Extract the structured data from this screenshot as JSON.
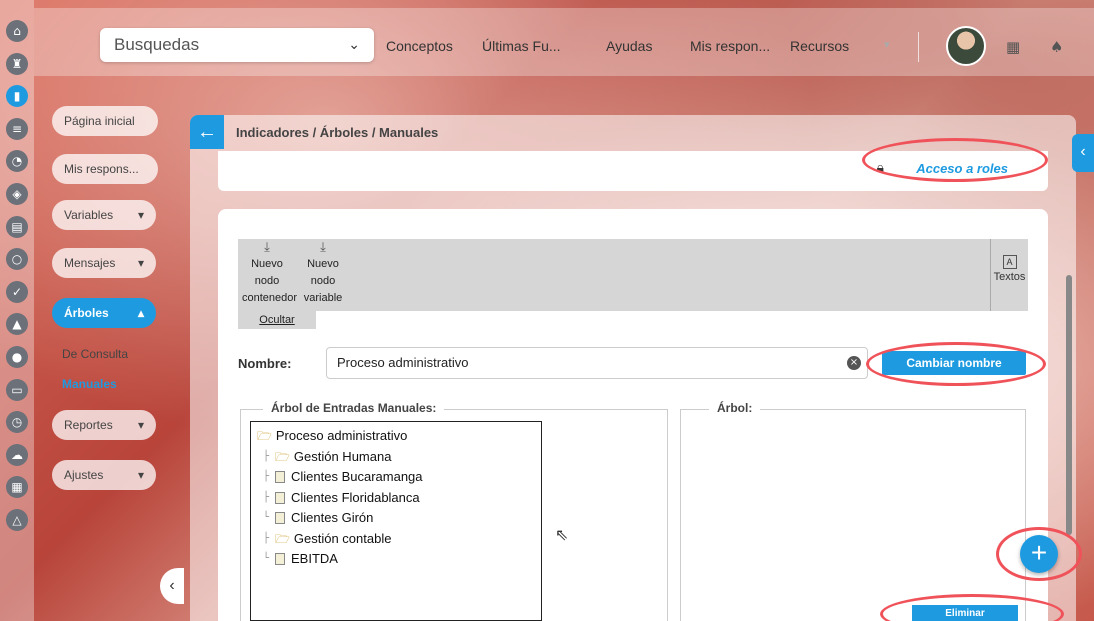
{
  "topbar": {
    "search_select": "Busquedas",
    "nav": [
      "Conceptos",
      "Últimas Fu...",
      "Ayudas",
      "Mis respon...",
      "Recursos"
    ],
    "nav_more": "▾"
  },
  "rail_icons": [
    "home-icon",
    "tower-icon",
    "chart-icon",
    "list-icon",
    "pie-icon",
    "shield-icon",
    "doc-icon",
    "circle-icon",
    "check-icon",
    "warning-icon",
    "people-icon",
    "monitor-icon",
    "clock-icon",
    "cloud-icon",
    "calendar-icon",
    "triangle-icon"
  ],
  "sidebar": {
    "items": [
      {
        "label": "Página inicial"
      },
      {
        "label": "Mis respons..."
      },
      {
        "label": "Variables",
        "arrow": "▾"
      },
      {
        "label": "Mensajes",
        "arrow": "▾"
      },
      {
        "label": "Árboles",
        "arrow": "▴"
      },
      {
        "label": "Reportes",
        "arrow": "▾"
      },
      {
        "label": "Ajustes",
        "arrow": "▾"
      }
    ],
    "subitems": [
      {
        "label": "De Consulta"
      },
      {
        "label": "Manuales"
      }
    ]
  },
  "panel": {
    "breadcrumb": "Indicadores / Árboles / Manuales",
    "roles_link": "Acceso a roles",
    "toolbar": {
      "tool1": [
        "Nuevo",
        "nodo",
        "contenedor"
      ],
      "tool2": [
        "Nuevo",
        "nodo",
        "variable"
      ],
      "texts": "Textos",
      "hide": "Ocultar"
    },
    "name_label": "Nombre:",
    "name_value": "Proceso administrativo",
    "rename_button": "Cambiar nombre",
    "left_legend": "Árbol de Entradas Manuales:",
    "right_legend": "Árbol:",
    "tree": [
      {
        "label": "Proceso administrativo",
        "type": "folder",
        "level": 0
      },
      {
        "label": "Gestión Humana",
        "type": "folder",
        "level": 1
      },
      {
        "label": "Clientes Bucaramanga",
        "type": "doc",
        "level": 1
      },
      {
        "label": "Clientes Floridablanca",
        "type": "doc",
        "level": 1
      },
      {
        "label": "Clientes Girón",
        "type": "doc",
        "level": 1
      },
      {
        "label": "Gestión contable",
        "type": "folder",
        "level": 1
      },
      {
        "label": "EBITDA",
        "type": "doc",
        "level": 1
      }
    ],
    "add_button": "+",
    "delete_button": "Eliminar"
  },
  "colors": {
    "accent": "#1e9be0",
    "highlight": "#f0525a"
  }
}
